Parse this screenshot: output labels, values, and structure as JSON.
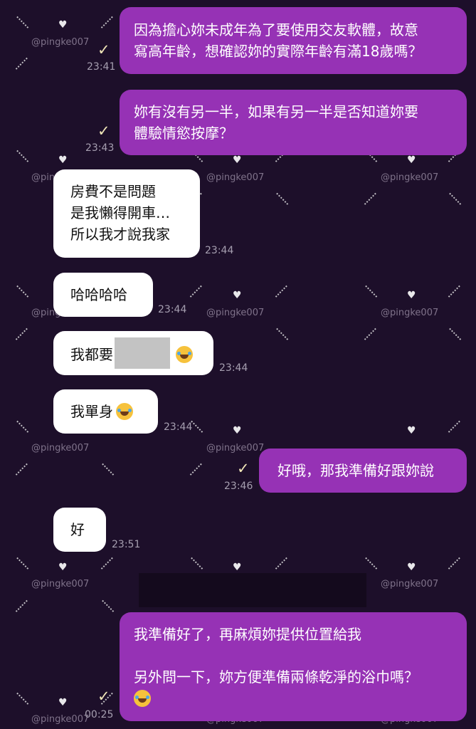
{
  "watermark": {
    "text": "@pingke007"
  },
  "messages": [
    {
      "side": "out",
      "lines": [
        "因為擔心妳未成年為了要使用交友軟體，故意",
        "寫高年齡，想確認妳的實際年齡有滿18歲嗎？"
      ],
      "time": "23:41",
      "read": true
    },
    {
      "side": "out",
      "lines": [
        "妳有沒有另一半，如果有另一半是否知道妳要",
        "體驗情慾按摩？"
      ],
      "time": "23:43",
      "read": true
    },
    {
      "side": "in",
      "lines": [
        "房費不是問題",
        "是我懶得開車…",
        "所以我才說我家"
      ],
      "time": "23:44"
    },
    {
      "side": "in",
      "lines": [
        "哈哈哈哈"
      ],
      "time": "23:44"
    },
    {
      "side": "in",
      "text_before": "我都要",
      "redacted": true,
      "emoji": "joy-emoji",
      "time": "23:44"
    },
    {
      "side": "in",
      "text_before": "我單身",
      "emoji": "joy-emoji",
      "time": "23:44"
    },
    {
      "side": "out",
      "lines": [
        "好哦，那我準備好跟妳說"
      ],
      "time": "23:46",
      "read": true
    },
    {
      "side": "in",
      "lines": [
        "好"
      ],
      "time": "23:51"
    },
    {
      "side": "out",
      "lines": [
        "我準備好了，再麻煩妳提供位置給我",
        "",
        "另外問一下，妳方便準備兩條乾淨的浴巾嗎？"
      ],
      "emoji_after": "joy-emoji",
      "time": "00:25",
      "read": true
    }
  ],
  "colors": {
    "outgoing": "#9632b5",
    "incoming": "#ffffff",
    "background": "#1d0f2a",
    "read_check": "#f0e6b8"
  }
}
